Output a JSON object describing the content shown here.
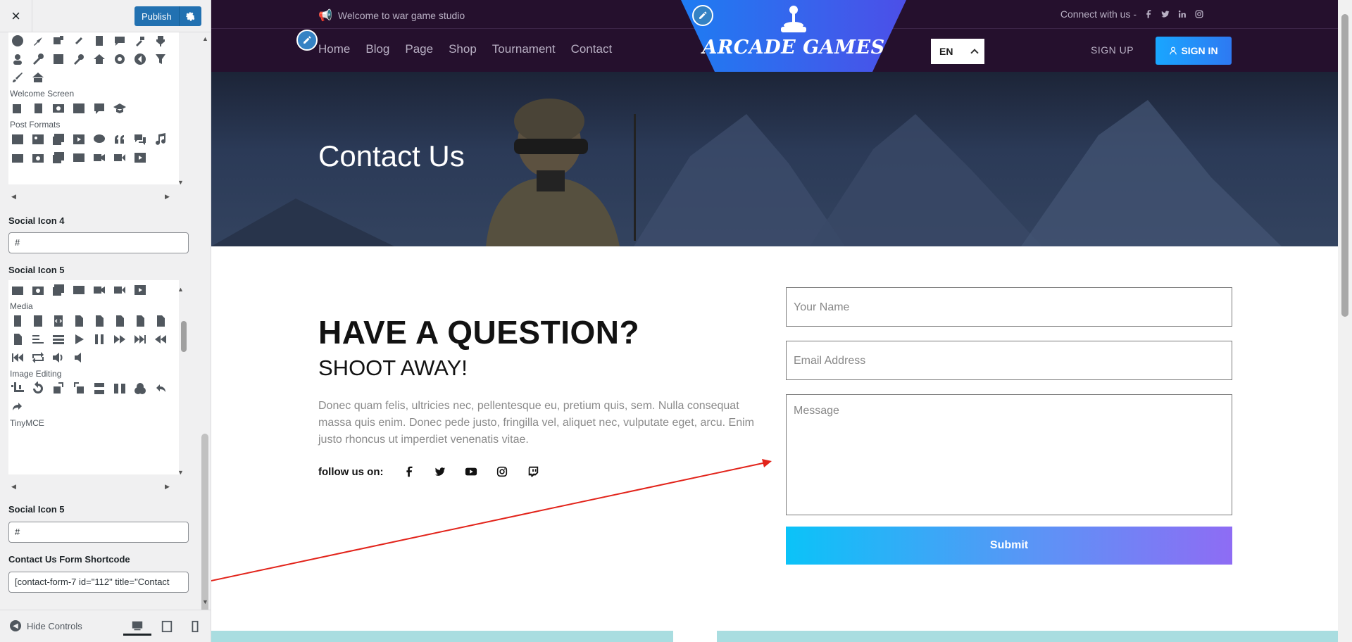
{
  "customizer": {
    "close_icon": "×",
    "publish_label": "Publish",
    "panel1": {
      "groups": [
        {
          "label": "Welcome Screen"
        },
        {
          "label": "Post Formats"
        }
      ]
    },
    "social4": {
      "label": "Social Icon 4",
      "value": "#"
    },
    "social5_panel": {
      "label": "Social Icon 5"
    },
    "panel2": {
      "groups": [
        {
          "label": "Media"
        },
        {
          "label": "Image Editing"
        },
        {
          "label": "TinyMCE"
        }
      ]
    },
    "social5": {
      "label": "Social Icon 5",
      "value": "#"
    },
    "shortcode": {
      "label": "Contact Us Form Shortcode",
      "value": "[contact-form-7 id=\"112\" title=\"Contact"
    },
    "hide_controls": "Hide Controls"
  },
  "site": {
    "welcome": "Welcome to war game studio",
    "connect": "Connect with us -",
    "nav": [
      "Home",
      "Blog",
      "Page",
      "Shop",
      "Tournament",
      "Contact"
    ],
    "logo": "ARCADE GAMES",
    "lang": "EN",
    "signup": "SIGN UP",
    "signin": "SIGN IN",
    "hero_title": "Contact Us",
    "heading": "HAVE A QUESTION?",
    "subheading": "SHOOT AWAY!",
    "paragraph": "Donec quam felis, ultricies nec, pellentesque eu, pretium quis, sem. Nulla consequat massa quis enim. Donec pede justo, fringilla vel, aliquet nec, vulputate eget, arcu. Enim justo rhoncus ut imperdiet venenatis vitae.",
    "follow_label": "follow us on:",
    "follow_icons": [
      "facebook-icon",
      "twitter-icon",
      "youtube-icon",
      "instagram-icon",
      "twitch-icon"
    ],
    "form": {
      "name_placeholder": "Your Name",
      "email_placeholder": "Email Address",
      "message_placeholder": "Message",
      "submit": "Submit"
    }
  },
  "colors": {
    "header_bg": "#25102d",
    "accent_blue": "#2271b1",
    "submit_start": "#0bc3f8",
    "submit_end": "#8e6cf4"
  }
}
